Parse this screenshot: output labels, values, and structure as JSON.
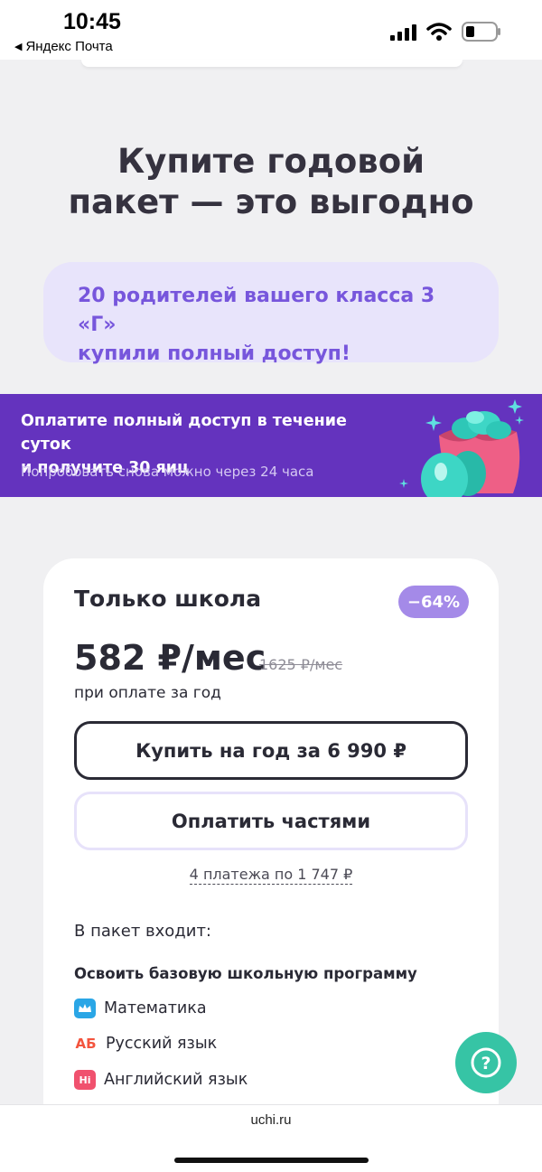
{
  "status_bar": {
    "time": "10:45",
    "back_app": "Яндекс Почта",
    "icons": [
      "back-arrow-icon",
      "signal-icon",
      "wifi-icon",
      "battery-icon"
    ]
  },
  "heading": {
    "line1": "Купите годовой",
    "line2": "пакет — это выгодно"
  },
  "parents_info": {
    "line1": "20 родителей вашего класса 3 «Г»",
    "line2": "купили полный доступ!"
  },
  "promo": {
    "title_line1": "Оплатите полный доступ в течение суток",
    "title_line2": "и получите 30 яиц",
    "note": "Попробовать снова можно через 24 часа"
  },
  "plan": {
    "title": "Только школа",
    "discount": "−64%",
    "price": "582 ₽/мес",
    "old_price": "1625 ₽/мес",
    "price_note": "при оплате за год",
    "buy_label": "Купить на год за 6 990 ₽",
    "installments_label": "Оплатить частями",
    "installments_link": "4 платежа по 1 747 ₽",
    "package_label": "В пакет входит:",
    "program_title": "Освоить базовую школьную программу",
    "subjects": [
      {
        "label": "Математика",
        "icon": "crown-icon"
      },
      {
        "label": "Русский язык",
        "icon": "ab-icon",
        "icon_text": "АБ"
      },
      {
        "label": "Английский язык",
        "icon": "hi-icon",
        "icon_text": "Hi"
      }
    ]
  },
  "help": {
    "symbol": "?"
  },
  "bottom_bar": {
    "domain": "uchi.ru"
  },
  "colors": {
    "accent_purple": "#6433be",
    "soft_purple": "#e8e4fb",
    "badge": "#a48ae8",
    "help_green": "#36c4a5"
  }
}
